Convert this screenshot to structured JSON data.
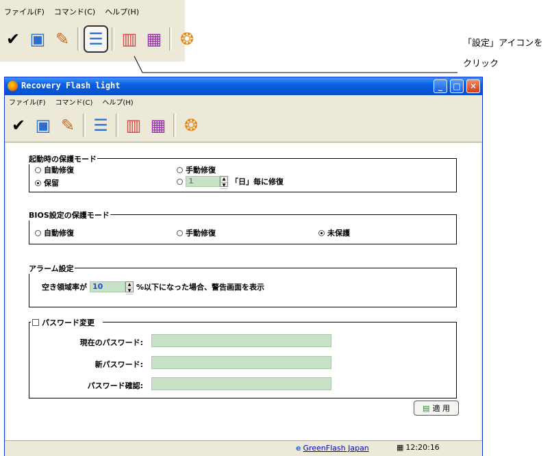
{
  "top": {
    "menu": [
      "ファイル(F)",
      "コマンド(C)",
      "ヘルプ(H)"
    ]
  },
  "annotation": {
    "line1": "「設定」アイコンを",
    "line2": "クリック"
  },
  "window": {
    "title": "Recovery Flash light",
    "menu": [
      "ファイル(F)",
      "コマンド(C)",
      "ヘルプ(H)"
    ]
  },
  "toolbar_icons": [
    "protect-icon",
    "restore-icon",
    "edit-icon",
    "settings-icon",
    "report-icon",
    "tools-icon",
    "info-icon"
  ],
  "startup_mode": {
    "title": "起動時の保護モード",
    "auto": "自動修復",
    "manual": "手動修復",
    "hold": "保留",
    "days_value": "1",
    "days_suffix": "「日」毎に修復",
    "selected": "保留"
  },
  "bios_mode": {
    "title": "BIOS設定の保護モード",
    "auto": "自動修復",
    "manual": "手動修復",
    "unprotected": "未保護",
    "selected": "未保護"
  },
  "alarm": {
    "title": "アラーム設定",
    "prefix": "空き領域率が",
    "value": "10",
    "suffix": "%以下になった場合、警告画面を表示"
  },
  "password": {
    "title": "パスワード変更",
    "current": "現在のパスワード:",
    "new": "新パスワード:",
    "confirm": "パスワード確認:"
  },
  "apply_label": "適 用",
  "status": {
    "link": "GreenFlash Japan",
    "time": "12:20:16"
  }
}
